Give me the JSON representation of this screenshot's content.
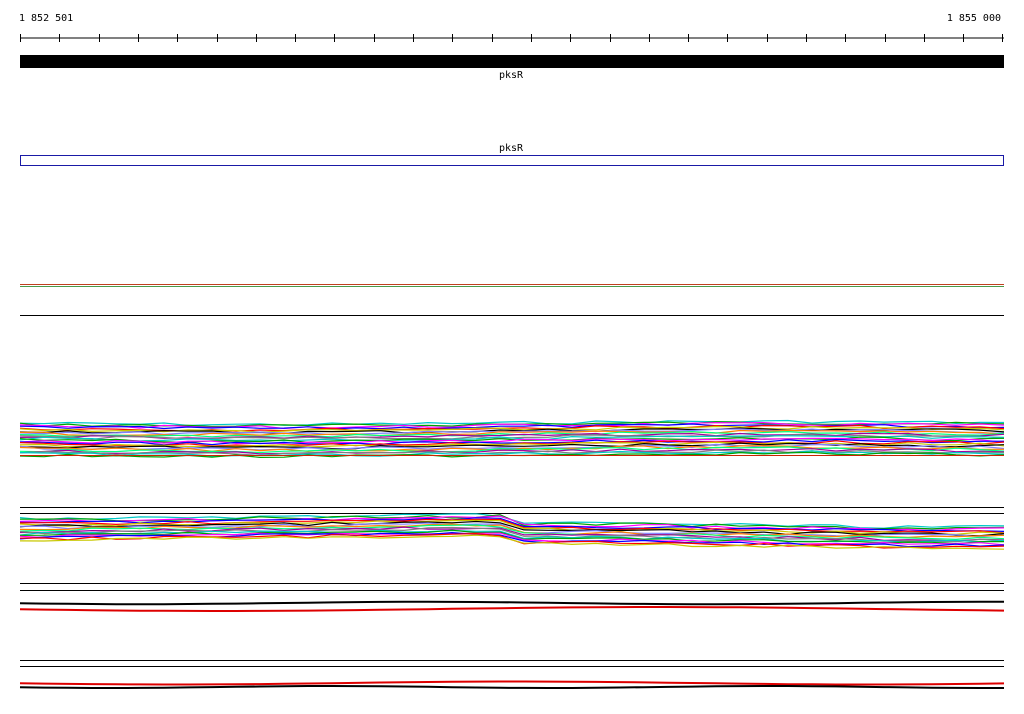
{
  "coordinates": {
    "start": "1 852 501",
    "end": "1 855 000"
  },
  "gene_tracks": [
    {
      "label": "pksR",
      "style": "filled"
    },
    {
      "label": "pksR",
      "style": "outline"
    }
  ],
  "colors": {
    "gene_fill": "#000000",
    "gene_outline": "#1a1aa6",
    "profile_palette": [
      "#00c8c8",
      "#00a000",
      "#ff00ff",
      "#0000ff",
      "#ff0000",
      "#c8c800",
      "#000000",
      "#8080ff",
      "#ff8000",
      "#00ff80",
      "#a000a0",
      "#808080"
    ]
  }
}
